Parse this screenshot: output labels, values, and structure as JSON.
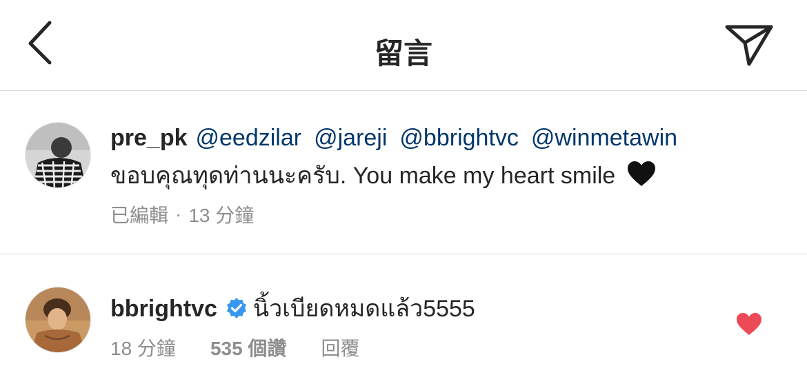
{
  "header": {
    "title": "留言"
  },
  "caption": {
    "username": "pre_pk",
    "mentions": [
      "@eedzilar",
      "@jareji",
      "@bbrightvc",
      "@winmetawin"
    ],
    "text": "ขอบคุณทุดท่านนะครับ. You make my heart smile",
    "emoji": "black-heart",
    "edited_label": "已編輯",
    "separator": "·",
    "time": "13 分鐘"
  },
  "comment": {
    "username": "bbrightvc",
    "verified": true,
    "text": "นิ้วเบียดหมดแล้ว5555",
    "time": "18 分鐘",
    "likes": "535 個讚",
    "reply_label": "回覆",
    "liked": true,
    "like_color": "#ed4956"
  },
  "colors": {
    "mention": "#00376b",
    "verified": "#3897f0",
    "meta": "#8e8e8e",
    "divider": "#dbdbdb"
  }
}
